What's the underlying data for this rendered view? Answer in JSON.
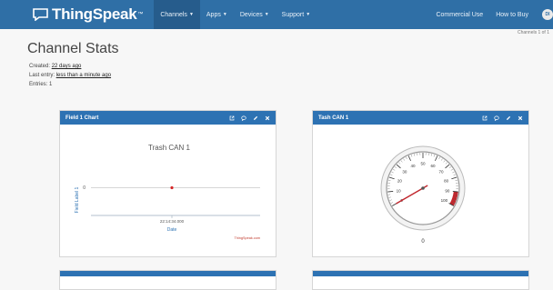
{
  "nav": {
    "brand": "ThingSpeak",
    "brand_tm": "™",
    "items": [
      {
        "label": "Channels",
        "caret": "▼"
      },
      {
        "label": "Apps",
        "caret": "▼"
      },
      {
        "label": "Devices",
        "caret": "▼"
      },
      {
        "label": "Support",
        "caret": "▼"
      }
    ],
    "right": [
      {
        "label": "Commercial Use"
      },
      {
        "label": "How to Buy"
      }
    ],
    "user_initials": "DI",
    "overflow_text": "Channels 1 of 1"
  },
  "page": {
    "title": "Channel Stats",
    "created_label": "Created:",
    "created_value": "22 days ago",
    "last_entry_label": "Last entry:",
    "last_entry_value": "less than a minute ago",
    "entries_label": "Entries:",
    "entries_value": "1"
  },
  "panels": {
    "chart": {
      "header": "Field 1 Chart"
    },
    "gauge": {
      "header": "Tash CAN 1"
    }
  },
  "icons": {
    "external": "external-link-icon",
    "comment": "comment-icon",
    "edit": "pencil-icon",
    "close": "close-icon"
  },
  "chart_data": [
    {
      "type": "line",
      "title": "Trash CAN 1",
      "xlabel": "Date",
      "ylabel": "Field Label 1",
      "x_ticks": [
        "22:14:34.000"
      ],
      "y_ticks": [
        0
      ],
      "series": [
        {
          "x": [
            "22:14:34.000"
          ],
          "values": [
            0
          ]
        }
      ],
      "credit": "ThingSpeak.com",
      "marker_color": "#d62728"
    },
    {
      "type": "gauge",
      "min": 0,
      "max": 100,
      "ticks": [
        0,
        10,
        20,
        30,
        40,
        50,
        60,
        70,
        80,
        90,
        100
      ],
      "value": 0,
      "value_label": "0",
      "red_zone": [
        90,
        100
      ],
      "red_color": "#c1272d"
    }
  ]
}
